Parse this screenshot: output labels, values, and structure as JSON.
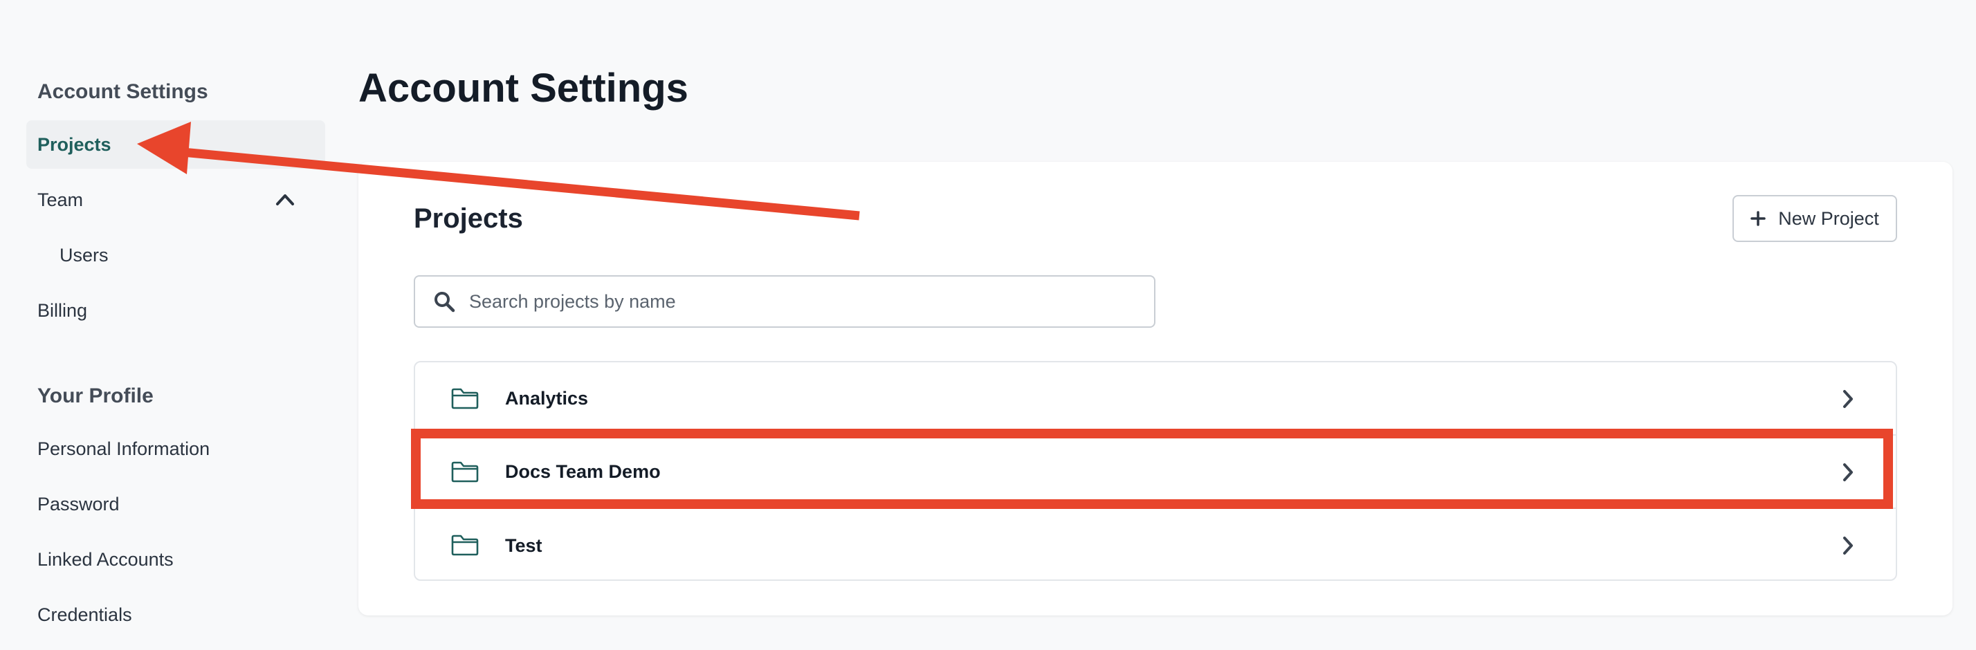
{
  "sidebar": {
    "account_title": "Account Settings",
    "items": [
      {
        "label": "Projects"
      },
      {
        "label": "Team"
      },
      {
        "label": "Users"
      },
      {
        "label": "Billing"
      }
    ],
    "profile_title": "Your Profile",
    "profile_items": [
      {
        "label": "Personal Information"
      },
      {
        "label": "Password"
      },
      {
        "label": "Linked Accounts"
      },
      {
        "label": "Credentials"
      }
    ]
  },
  "main": {
    "page_title": "Account Settings",
    "card_title": "Projects",
    "new_project_label": "New Project",
    "search_placeholder": "Search projects by name",
    "projects": [
      {
        "name": "Analytics"
      },
      {
        "name": "Docs Team Demo"
      },
      {
        "name": "Test"
      }
    ]
  },
  "annotation": {
    "color": "#e8452c",
    "highlighted_project": "Docs Team Demo",
    "arrow_target": "Projects"
  },
  "colors": {
    "accent": "#1f5f5c",
    "background": "#f8f9fa",
    "card": "#ffffff"
  },
  "icons": [
    "chevron-up-icon",
    "plus-icon",
    "search-icon",
    "folder-icon",
    "chevron-right-icon"
  ]
}
